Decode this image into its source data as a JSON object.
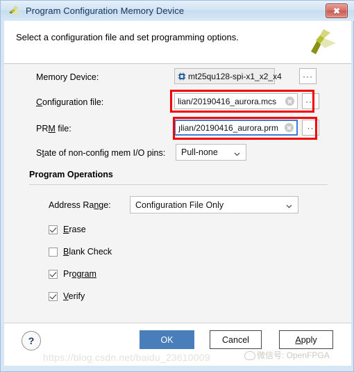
{
  "window": {
    "title": "Program Configuration Memory Device",
    "close_label": "✖",
    "app_icon": "xilinx-logo-icon"
  },
  "header": {
    "instruction": "Select a configuration file and set programming options.",
    "logo": "xilinx-pinwheel-logo"
  },
  "form": {
    "memory_device": {
      "label": "Memory Device:",
      "value": "mt25qu128-spi-x1_x2_x4",
      "icon": "memory-chip-icon",
      "browse_label": "···"
    },
    "configuration_file": {
      "label_pre": "C",
      "label_post": "onfiguration file:",
      "value": "lian/20190416_aurora.mcs",
      "clear_icon": "clear-circle-icon",
      "browse_label": "···"
    },
    "prm_file": {
      "label_pre": "PRM",
      "label_mn": "M",
      "label_post": " file:",
      "label_a": "PR",
      "label_b": "M",
      "label_c": " file:",
      "value": "յlian/20190416_aurora.prm",
      "clear_icon": "clear-circle-icon",
      "browse_label": "··"
    },
    "io_pins": {
      "label_a": "S",
      "label_b": "t",
      "label_c": "ate of non-config mem I/O pins:",
      "value": "Pull-none",
      "chevron": "chevron-down-icon"
    }
  },
  "program_operations": {
    "title": "Program Operations",
    "address_range": {
      "label_a": "Address Ra",
      "label_b": "n",
      "label_c": "ge:",
      "value": "Configuration File Only",
      "chevron": "chevron-down-icon"
    },
    "checkboxes": [
      {
        "name": "erase",
        "label_a": "E",
        "label_b": "rase",
        "checked": true
      },
      {
        "name": "blank-check",
        "label_a": "B",
        "label_b": "lank Check",
        "checked": false
      },
      {
        "name": "program",
        "label_a": "Pr",
        "label_b": "ogram",
        "checked": true,
        "mn_offset": true
      },
      {
        "name": "verify",
        "label_a": "V",
        "label_b": "erify",
        "checked": true
      }
    ]
  },
  "footer": {
    "help_label": "?",
    "ok_label": "OK",
    "cancel_label": "Cancel",
    "apply_a": "A",
    "apply_b": "pply"
  },
  "watermark": {
    "url": "https://blog.csdn.net/baidu_23610009",
    "wechat": "微信号: OpenFPGA"
  },
  "colors": {
    "accent": "#4a7ebb",
    "annotation": "#f40000",
    "focus": "#3a7fd5",
    "logo_light": "#d6d98a",
    "logo_mid": "#c4ca3c",
    "logo_dark": "#8f9418"
  }
}
